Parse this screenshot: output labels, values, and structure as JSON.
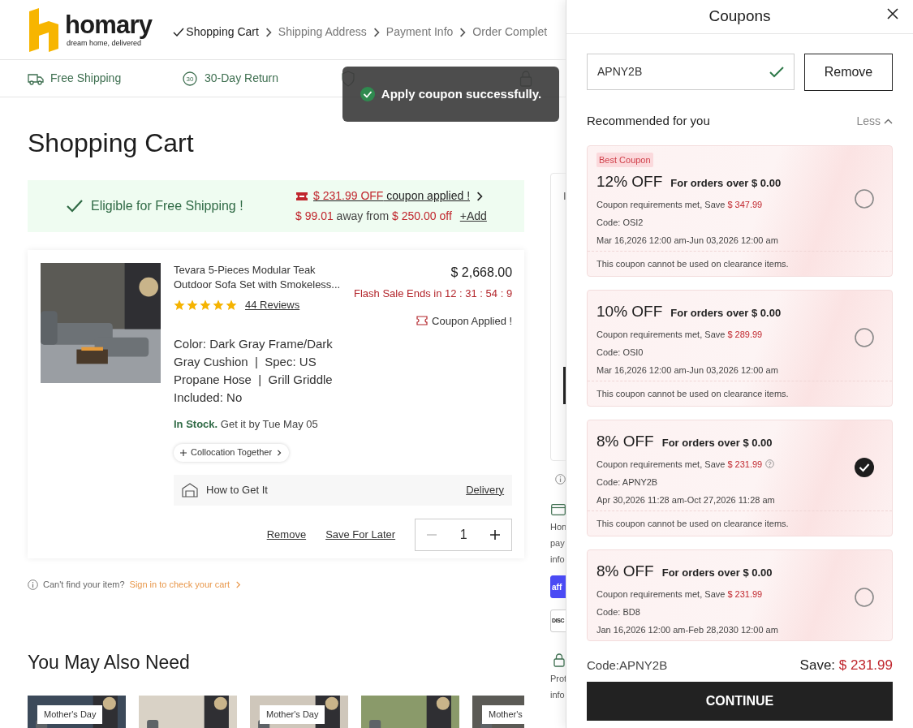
{
  "header": {
    "logo": {
      "name": "homary",
      "tagline": "dream home, delivered"
    },
    "steps": [
      {
        "label": "Shopping Cart",
        "selected": true
      },
      {
        "label": "Shipping Address",
        "selected": false
      },
      {
        "label": "Payment Info",
        "selected": false
      },
      {
        "label": "Order Complet",
        "selected": false
      }
    ]
  },
  "trust_bar": [
    {
      "kind": "truck",
      "label": "Free Shipping"
    },
    {
      "kind": "return",
      "label": "30-Day Return",
      "icon_text": "30"
    },
    {
      "kind": "shield"
    },
    {
      "kind": "lock"
    }
  ],
  "toast": {
    "message": "Apply coupon successfully."
  },
  "page_title": "Shopping Cart",
  "shipping_banner": {
    "eligible": "Eligible for Free Shipping !",
    "coupon_amount": "$ 231.99 OFF",
    "coupon_text": "coupon applied !",
    "away_amount": "$ 99.01",
    "away_text": "away from",
    "threshold": "$ 250.00 off",
    "add_link": "+Add"
  },
  "cart_item": {
    "title": "Tevara 5-Pieces Modular Teak Outdoor Sofa Set with Smokeless...",
    "stars": 5,
    "reviews": "44 Reviews",
    "price": "$ 2,668.00",
    "flash_sale_label": "Flash Sale Ends in",
    "countdown": "12 : 31 : 54 : 9",
    "coupon_status": "Coupon Applied !",
    "spec": "Color: Dark Gray Frame/Dark Gray Cushion  |  Spec: US Propane Hose  |  Grill Griddle Included: No",
    "stock": "In Stock.",
    "delivery_estimate": "Get it by Tue May 05",
    "collocation": "Collocation Together",
    "how_to_get": "How to Get It",
    "delivery_method": "Delivery",
    "actions": [
      "Remove",
      "Save For Later"
    ],
    "quantity": "1"
  },
  "signin_hint": {
    "text": "Can't find your item?",
    "link": "Sign in to check your cart"
  },
  "recommendations": {
    "title": "You May Also Need",
    "items": [
      {
        "kind": "picture",
        "badge": "Mother's Day"
      },
      {
        "kind": "picture"
      },
      {
        "kind": "picture",
        "badge": "Mother's Day"
      },
      {
        "kind": "picture"
      },
      {
        "kind": "picture",
        "badge": "Mother's"
      }
    ]
  },
  "order_summary": {
    "fragments": [
      "I"
    ]
  },
  "payment_info": {
    "lines": [
      "Hon",
      "pay",
      "info"
    ],
    "badges": [
      {
        "kind": "affirm",
        "label": "aff"
      },
      {
        "kind": "discover",
        "label": "DISC"
      }
    ],
    "security_lines": [
      "Prot",
      "info"
    ]
  },
  "coupons_drawer": {
    "title": "Coupons",
    "code_input": {
      "value": "APNY2B",
      "valid": true
    },
    "remove_button": "Remove",
    "section_title": "Recommended for you",
    "toggle": "Less",
    "coupons": [
      {
        "best": true,
        "badge": "Best Coupon",
        "discount": "12% OFF",
        "minimum": "For orders over $ 0.00",
        "requirement": "Coupon requirements met, Save",
        "save": "$ 347.99",
        "help": false,
        "code": "Code: OSI2",
        "validity": "Mar 16,2026 12:00 am-Jun 03,2026 12:00 am",
        "note": "This coupon cannot be used on clearance items.",
        "selected": false
      },
      {
        "best": false,
        "discount": "10% OFF",
        "minimum": "For orders over $ 0.00",
        "requirement": "Coupon requirements met, Save",
        "save": "$ 289.99",
        "help": false,
        "code": "Code: OSI0",
        "validity": "Mar 16,2026 12:00 am-Jun 03,2026 12:00 am",
        "note": "This coupon cannot be used on clearance items.",
        "selected": false
      },
      {
        "best": false,
        "discount": "8% OFF",
        "minimum": "For orders over $ 0.00",
        "requirement": "Coupon requirements met, Save",
        "save": "$ 231.99",
        "help": true,
        "code": "Code: APNY2B",
        "validity": "Apr 30,2026 11:28 am-Oct 27,2026 11:28 am",
        "note": "This coupon cannot be used on clearance items.",
        "selected": true
      },
      {
        "best": false,
        "discount": "8% OFF",
        "minimum": "For orders over $ 0.00",
        "requirement": "Coupon requirements met, Save",
        "save": "$ 231.99",
        "help": false,
        "code": "Code: BD8",
        "validity": "Jan 16,2026 12:00 am-Feb 28,2030 12:00 am",
        "selected": false
      }
    ],
    "footer": {
      "code": "Code:APNY2B",
      "save_label": "Save:",
      "save_amount": "$ 231.99",
      "continue": "CONTINUE"
    }
  }
}
